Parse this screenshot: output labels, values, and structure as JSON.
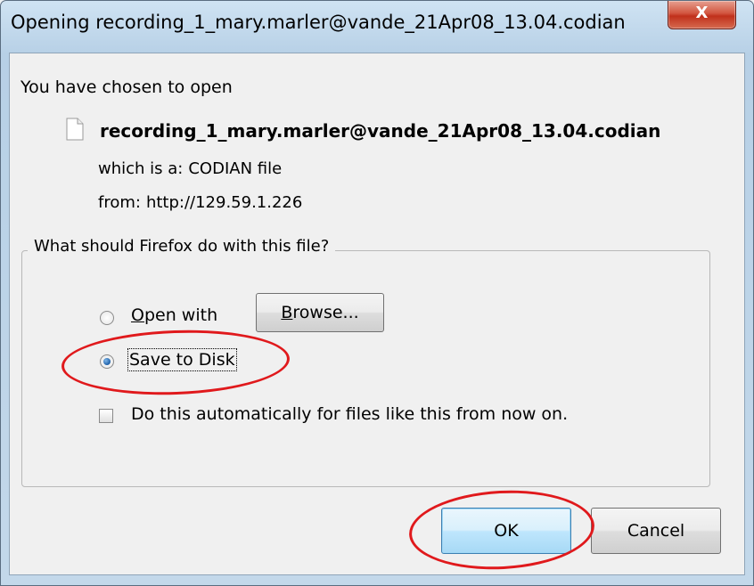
{
  "dialog": {
    "title": "Opening recording_1_mary.marler@vande_21Apr08_13.04.codian",
    "close_glyph": "X"
  },
  "content": {
    "intro": "You have chosen to open",
    "file_name": "recording_1_mary.marler@vande_21Apr08_13.04.codian",
    "type_label": "which is a:",
    "type_value": "CODIAN file",
    "from_label": "from:",
    "from_value": "http://129.59.1.226"
  },
  "action_group": {
    "legend": "What should Firefox do with this file?",
    "open_with_label": "Open with",
    "browse_label": "Browse...",
    "save_label": "Save to Disk",
    "selected_option": "save_to_disk",
    "auto_label": "Do this automatically for files like this from now on.",
    "auto_checked": false
  },
  "buttons": {
    "ok": "OK",
    "cancel": "Cancel"
  },
  "annotations": {
    "color": "#e0191c"
  }
}
